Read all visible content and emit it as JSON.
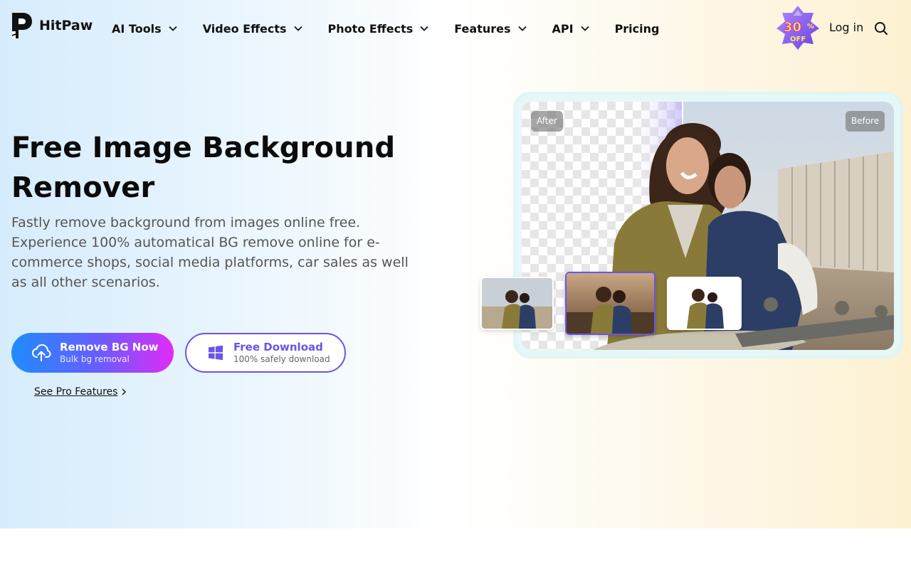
{
  "brand": {
    "name": "HitPaw"
  },
  "nav": {
    "items": [
      {
        "label": "AI Tools",
        "has_dropdown": true
      },
      {
        "label": "Video Effects",
        "has_dropdown": true
      },
      {
        "label": "Photo Effects",
        "has_dropdown": true
      },
      {
        "label": "Features",
        "has_dropdown": true
      },
      {
        "label": "API",
        "has_dropdown": true
      },
      {
        "label": "Pricing",
        "has_dropdown": false
      }
    ],
    "promo_badge": {
      "percent": "30",
      "percent_sign": "%",
      "text": "OFF"
    },
    "login_label": "Log in",
    "search_icon": "search-icon"
  },
  "hero": {
    "title": "Free Image Background Remover",
    "description": "Fastly remove background from images online free. Experience 100% automatical BG remove online for e-commerce shops, social media platforms, car sales as well as all other scenarios.",
    "primary_button": {
      "title": "Remove BG Now",
      "subtitle": "Bulk bg removal",
      "icon": "upload-cloud-icon"
    },
    "secondary_button": {
      "title": "Free Download",
      "subtitle": "100% safely download",
      "icon": "windows-icon"
    },
    "pro_link": "See Pro Features"
  },
  "showcase": {
    "after_label": "After",
    "before_label": "Before",
    "selected_thumbnail": 2
  },
  "colors": {
    "accent": "#6b54e8",
    "gradient_start": "#1f8cff",
    "gradient_end": "#e12bf5"
  }
}
